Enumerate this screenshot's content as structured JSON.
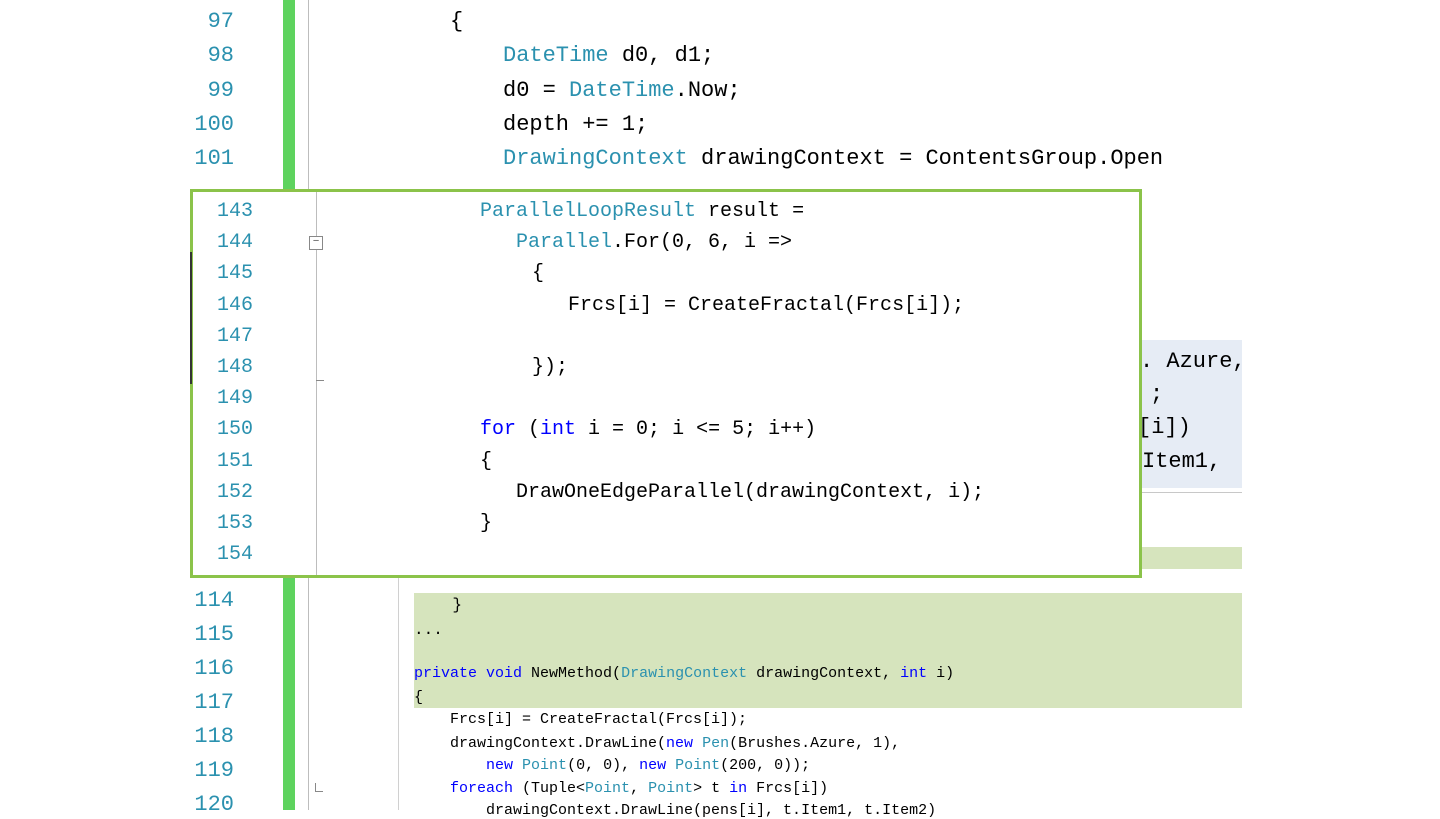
{
  "back_editor": {
    "top_lines": [
      {
        "num": "97",
        "parts": [
          {
            "t": "{",
            "c": ""
          }
        ]
      },
      {
        "num": "98",
        "parts": [
          {
            "t": "DateTime",
            "c": "ty"
          },
          {
            "t": " d0, d1;",
            "c": ""
          }
        ]
      },
      {
        "num": "99",
        "parts": [
          {
            "t": "d0 = ",
            "c": ""
          },
          {
            "t": "DateTime",
            "c": "ty"
          },
          {
            "t": ".Now;",
            "c": ""
          }
        ]
      },
      {
        "num": "100",
        "parts": [
          {
            "t": "depth += 1;",
            "c": ""
          }
        ]
      },
      {
        "num": "101",
        "parts": [
          {
            "t": "DrawingContext",
            "c": "ty"
          },
          {
            "t": " drawingContext = ContentsGroup.Open",
            "c": ""
          }
        ]
      }
    ],
    "partial_lines": [
      ". Azure,",
      ";",
      "[i])",
      "Item1,"
    ],
    "bottom_line_numbers": [
      "114",
      "115",
      "116",
      "117",
      "118",
      "119",
      "120"
    ]
  },
  "diff_block": {
    "lines": [
      {
        "size": "big",
        "parts": [
          {
            "t": "    }",
            "c": ""
          }
        ]
      },
      {
        "size": "big",
        "parts": [
          {
            "t": "...",
            "c": ""
          }
        ]
      },
      {
        "size": "small",
        "parts": [
          {
            "t": "private void",
            "c": "kw"
          },
          {
            "t": " NewMethod(",
            "c": ""
          },
          {
            "t": "DrawingContext",
            "c": "ty"
          },
          {
            "t": " drawingContext, ",
            "c": ""
          },
          {
            "t": "int",
            "c": "kw"
          },
          {
            "t": " i)",
            "c": ""
          }
        ]
      },
      {
        "size": "small",
        "parts": [
          {
            "t": "{",
            "c": ""
          }
        ]
      },
      {
        "size": "small",
        "parts": [
          {
            "t": "    Frcs[i] = CreateFractal(Frcs[i]);",
            "c": ""
          }
        ]
      },
      {
        "size": "small",
        "parts": [
          {
            "t": "    drawingContext.DrawLine(",
            "c": ""
          },
          {
            "t": "new",
            "c": "kw"
          },
          {
            "t": " ",
            "c": ""
          },
          {
            "t": "Pen",
            "c": "ty"
          },
          {
            "t": "(Brushes.Azure, 1),",
            "c": ""
          }
        ]
      },
      {
        "size": "small",
        "parts": [
          {
            "t": "        ",
            "c": ""
          },
          {
            "t": "new",
            "c": "kw"
          },
          {
            "t": " ",
            "c": ""
          },
          {
            "t": "Point",
            "c": "ty"
          },
          {
            "t": "(0, 0), ",
            "c": ""
          },
          {
            "t": "new",
            "c": "kw"
          },
          {
            "t": " ",
            "c": ""
          },
          {
            "t": "Point",
            "c": "ty"
          },
          {
            "t": "(200, 0));",
            "c": ""
          }
        ]
      },
      {
        "size": "small",
        "parts": [
          {
            "t": "    foreach",
            "c": "kw"
          },
          {
            "t": " (Tuple<",
            "c": ""
          },
          {
            "t": "Point",
            "c": "ty"
          },
          {
            "t": ", ",
            "c": ""
          },
          {
            "t": "Point",
            "c": "ty"
          },
          {
            "t": "> t ",
            "c": ""
          },
          {
            "t": "in",
            "c": "kw"
          },
          {
            "t": " Frcs[i])",
            "c": ""
          }
        ]
      },
      {
        "size": "small",
        "parts": [
          {
            "t": "        drawingContext.DrawLine(pens[i], t.Item1, t.Item2)",
            "c": ""
          }
        ]
      }
    ]
  },
  "popup": {
    "lines": [
      {
        "num": "143",
        "parts": [
          {
            "t": "ParallelLoopResult",
            "c": "ty"
          },
          {
            "t": " result =",
            "c": ""
          }
        ]
      },
      {
        "num": "144",
        "collapse": true,
        "parts": [
          {
            "t": "   ",
            "c": ""
          },
          {
            "t": "Parallel",
            "c": "ty"
          },
          {
            "t": ".For(0, 6, i =>",
            "c": ""
          }
        ]
      },
      {
        "num": "145",
        "parts": [
          {
            "t": "  {",
            "c": ""
          }
        ]
      },
      {
        "num": "146",
        "parts": [
          {
            "t": "     Frcs[i] = CreateFractal(Frcs[i]);",
            "c": ""
          }
        ]
      },
      {
        "num": "147",
        "parts": [
          {
            "t": "",
            "c": ""
          }
        ]
      },
      {
        "num": "148",
        "parts": [
          {
            "t": "  });",
            "c": ""
          }
        ]
      },
      {
        "num": "149",
        "parts": [
          {
            "t": "",
            "c": ""
          }
        ]
      },
      {
        "num": "150",
        "parts": [
          {
            "t": "for",
            "c": "kw"
          },
          {
            "t": " (",
            "c": ""
          },
          {
            "t": "int",
            "c": "kw"
          },
          {
            "t": " i = 0; i <= 5; i++)",
            "c": ""
          }
        ]
      },
      {
        "num": "151",
        "parts": [
          {
            "t": "{",
            "c": ""
          }
        ]
      },
      {
        "num": "152",
        "parts": [
          {
            "t": "   DrawOneEdgeParallel(drawingContext, i);",
            "c": ""
          }
        ]
      },
      {
        "num": "153",
        "parts": [
          {
            "t": "}",
            "c": ""
          }
        ]
      },
      {
        "num": "154",
        "parts": [
          {
            "t": "",
            "c": ""
          }
        ]
      }
    ],
    "collapse_symbol": "⊟"
  },
  "colors": {
    "line_number": "#2b91af",
    "keyword": "#0000ff",
    "type": "#2b91af",
    "change_bar": "#5ed35e",
    "diff_highlight": "#d6e4bd",
    "popup_border": "#8bc34a"
  }
}
